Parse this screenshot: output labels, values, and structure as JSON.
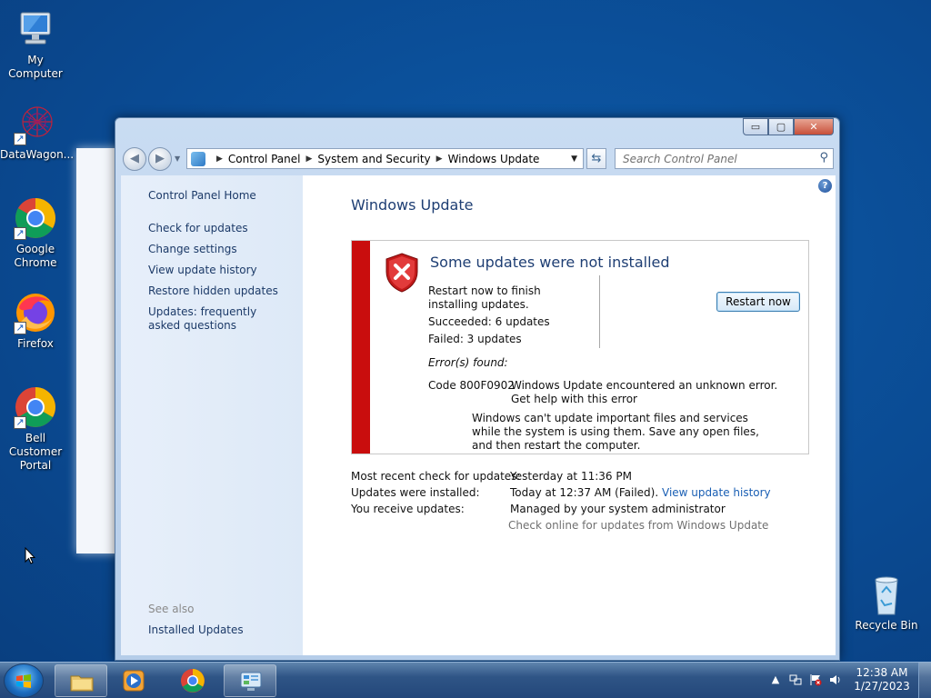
{
  "desktop": {
    "icons": [
      {
        "label": "My Computer"
      },
      {
        "label": "DataWagon..."
      },
      {
        "label": "Google Chrome"
      },
      {
        "label": "Firefox"
      },
      {
        "label": "Bell Customer Portal"
      },
      {
        "label": "Recycle Bin"
      }
    ]
  },
  "window": {
    "breadcrumb": [
      "Control Panel",
      "System and Security",
      "Windows Update"
    ],
    "search_placeholder": "Search Control Panel",
    "caption_buttons": {
      "minimize": "▭",
      "maximize": "▢",
      "close": "✕"
    }
  },
  "sidebar": {
    "home": "Control Panel Home",
    "links": [
      "Check for updates",
      "Change settings",
      "View update history",
      "Restore hidden updates",
      "Updates: frequently asked questions"
    ],
    "see_also_label": "See also",
    "see_also_links": [
      "Installed Updates"
    ]
  },
  "main": {
    "title": "Windows Update",
    "status": {
      "heading": "Some updates were not installed",
      "message": "Restart now to finish installing updates.",
      "succeeded": "Succeeded: 6 updates",
      "failed": "Failed: 3 updates",
      "restart_button": "Restart now",
      "errors_label": "Error(s) found:",
      "error_code": "Code 800F0902",
      "error_text": "Windows Update encountered an unknown error.",
      "error_help_link": "Get help with this error",
      "warning": "Windows can't update important files and services while the system is using them. Save any open files, and then restart the computer."
    },
    "details": [
      {
        "label": "Most recent check for updates:",
        "value": "Yesterday at 11:36 PM"
      },
      {
        "label": "Updates were installed:",
        "value": "Today at 12:37 AM (Failed).",
        "link": "View update history"
      },
      {
        "label": "You receive updates:",
        "value": "Managed by your system administrator"
      }
    ],
    "online_check": "Check online for updates from Windows Update"
  },
  "taskbar": {
    "clock_time": "12:38 AM",
    "clock_date": "1/27/2023"
  },
  "colors": {
    "error_bar": "#c90d0d",
    "link": "#1a5fb4",
    "heading": "#1e3e73",
    "desktop": "#0c4e9c"
  }
}
